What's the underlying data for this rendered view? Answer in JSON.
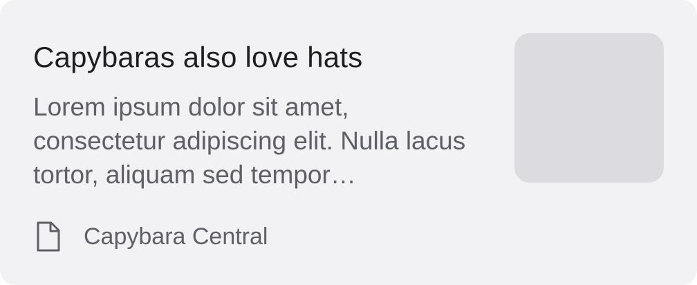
{
  "card": {
    "title": "Capybaras also love hats",
    "summary": "Lorem ipsum dolor sit amet, consectetur adipiscing elit. Nulla lacus tortor, aliquam sed tempor…",
    "source": {
      "icon": "document-icon",
      "name": "Capybara Central"
    },
    "thumbnail": {
      "color": "#dcdce0"
    }
  },
  "colors": {
    "card_background": "#f2f2f4",
    "title_text": "#1f1f1f",
    "secondary_text": "#5f6066"
  }
}
